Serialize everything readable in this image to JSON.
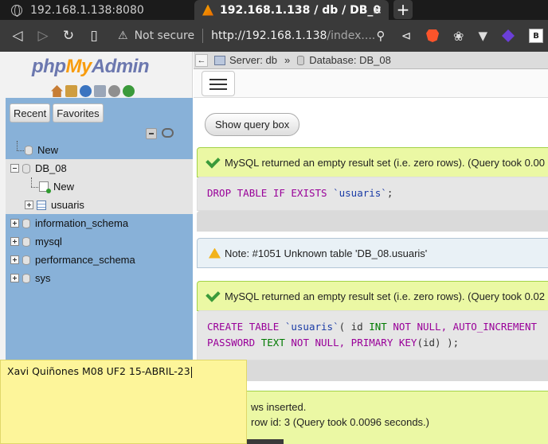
{
  "browser": {
    "tabs": [
      {
        "title": "192.168.1.138:8080"
      },
      {
        "title": "192.168.1.138 / db / DB_0",
        "close": "✕"
      }
    ],
    "new_tab": "+",
    "security_label": "Not secure",
    "url_host": "http://192.168.1.138",
    "url_rest": "/index....",
    "extension_badge": "B"
  },
  "pma": {
    "logo_php": "php",
    "logo_my": "My",
    "logo_admin": "Admin",
    "nav_buttons": {
      "recent": "Recent",
      "favorites": "Favorites"
    },
    "tree": [
      {
        "label": "New"
      },
      {
        "label": "DB_08"
      },
      {
        "label": "New"
      },
      {
        "label": "usuaris"
      },
      {
        "label": "information_schema"
      },
      {
        "label": "mysql"
      },
      {
        "label": "performance_schema"
      },
      {
        "label": "sys"
      }
    ],
    "breadcrumb": {
      "arrow": "←",
      "server": "Server: db",
      "sep": "»",
      "database": "Database: DB_08"
    },
    "show_query_box": "Show query box",
    "messages": {
      "success1": "MySQL returned an empty result set (i.e. zero rows). (Query took 0.00",
      "notice": "Note: #1051 Unknown table 'DB_08.usuaris'",
      "success2": "MySQL returned an empty result set (i.e. zero rows). (Query took 0.02",
      "rows_inserted": "ws inserted.",
      "insert_id": "row id: 3 (Query took 0.0096 seconds.)"
    },
    "sql1": {
      "drop": "DROP",
      "table": "TABLE",
      "if": "IF",
      "exists": "EXISTS",
      "name": "`usuaris`",
      "end": ";"
    },
    "sql2": {
      "create": "CREATE",
      "table": "TABLE",
      "name": "`usuaris`",
      "paren": "(",
      "id": "id",
      "int": "INT",
      "not": "NOT",
      "null": "NULL,",
      "auto": "AUTO_INCREMENT",
      "password": "PASSWORD",
      "text": "TEXT",
      "not2": "NOT",
      "null2": "NULL,",
      "primary": "PRIMARY KEY",
      "pk_args": "(id)",
      "close": ");"
    }
  },
  "sticky_note": {
    "text": "Xavi Quiñones M08 UF2 15-ABRIL-23"
  }
}
